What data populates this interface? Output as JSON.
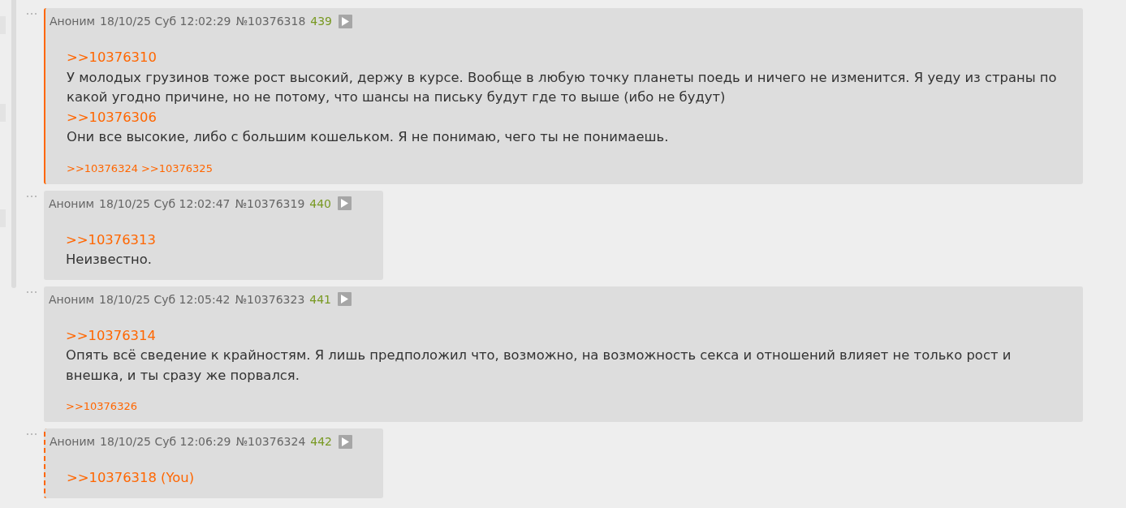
{
  "posts": [
    {
      "reply_to_you": true,
      "own": false,
      "author": "Аноним",
      "date": "18/10/25 Суб 12:02:29",
      "number": "№10376318",
      "count": "439",
      "body": [
        {
          "kind": "link",
          "text": ">>10376310"
        },
        {
          "kind": "text",
          "text": "У молодых грузинов тоже рост высокий, держу в курсе. Вообще в любую точку планеты поедь и ничего не изменится. Я уеду из страны по какой угодно причине, но не потому, что шансы на письку будут где то выше (ибо не будут)"
        },
        {
          "kind": "link",
          "text": ">>10376306"
        },
        {
          "kind": "text",
          "text": "Они все высокие, либо с большим кошельком. Я не понимаю, чего ты не понимаешь."
        }
      ],
      "replies": [
        ">>10376324",
        ">>10376325"
      ]
    },
    {
      "reply_to_you": false,
      "own": false,
      "author": "Аноним",
      "date": "18/10/25 Суб 12:02:47",
      "number": "№10376319",
      "count": "440",
      "body": [
        {
          "kind": "link",
          "text": ">>10376313"
        },
        {
          "kind": "text",
          "text": "Неизвестно."
        }
      ]
    },
    {
      "reply_to_you": false,
      "own": false,
      "author": "Аноним",
      "date": "18/10/25 Суб 12:05:42",
      "number": "№10376323",
      "count": "441",
      "body": [
        {
          "kind": "link",
          "text": ">>10376314"
        },
        {
          "kind": "text",
          "text": "Опять всё сведение к крайностям. Я лишь предположил что, возможно, на возможность секса и отношений влияет не только рост и внешка, и ты сразу же порвался."
        }
      ],
      "replies": [
        ">>10376326"
      ]
    },
    {
      "reply_to_you": false,
      "own": true,
      "author": "Аноним",
      "date": "18/10/25 Суб 12:06:29",
      "number": "№10376324",
      "count": "442",
      "body": [
        {
          "kind": "link",
          "text": ">>10376318 (You)"
        }
      ]
    }
  ]
}
